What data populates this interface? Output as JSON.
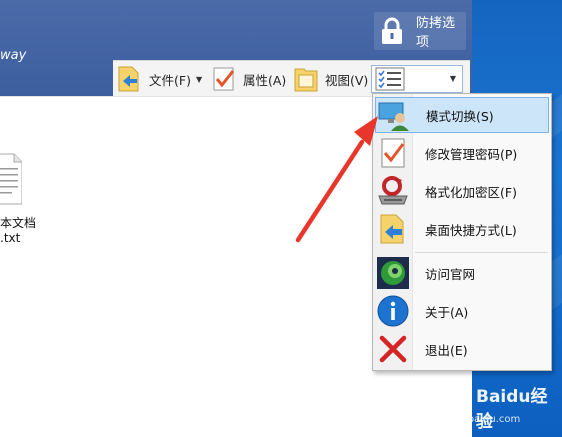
{
  "brand_partial": "way",
  "protect_button": {
    "label": "防拷选项",
    "icon": "lock-icon"
  },
  "toolbar": {
    "file_label": "文件(F)",
    "properties_label": "属性(A)",
    "view_label": "视图(V)",
    "mode_dropdown_icon": "checklist-icon"
  },
  "file": {
    "name_line1": "本文档",
    "name_line2": ".txt",
    "icon": "text-document-icon"
  },
  "menu": {
    "items": [
      {
        "label": "模式切换(S)",
        "icon": "user-monitor-icon",
        "selected": true
      },
      {
        "label": "修改管理密码(P)",
        "icon": "checkmark-doc-icon",
        "selected": false
      },
      {
        "label": "格式化加密区(F)",
        "icon": "format-drive-icon",
        "selected": false
      },
      {
        "label": "桌面快捷方式(L)",
        "icon": "shortcut-folder-icon",
        "selected": false
      },
      {
        "label": "访问官网",
        "icon": "globe-eye-icon",
        "selected": false
      },
      {
        "label": "关于(A)",
        "icon": "info-icon",
        "selected": false
      },
      {
        "label": "退出(E)",
        "icon": "red-x-icon",
        "selected": false
      }
    ]
  },
  "watermark": {
    "text": "Baidu经验",
    "sub": "jingyan.baidu.com"
  },
  "colors": {
    "title_band": "#4263a3",
    "desktop_blue": "#1976d2",
    "menu_highlight": "#cde5f9",
    "annotation_red": "#e8362b"
  }
}
